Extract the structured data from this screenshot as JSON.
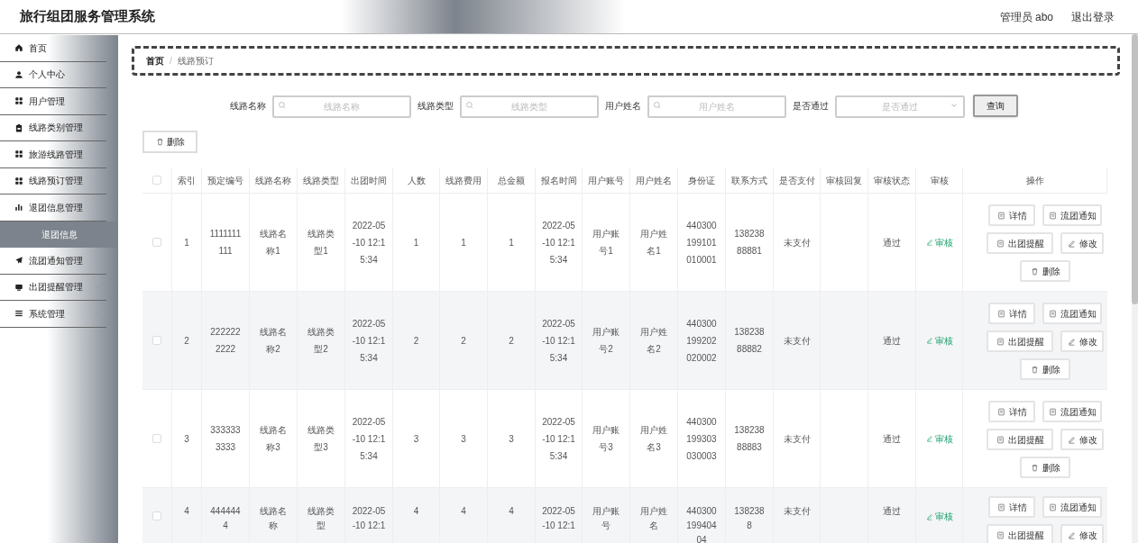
{
  "header": {
    "title": "旅行组团服务管理系统",
    "user": "管理员 abo",
    "logout": "退出登录"
  },
  "sidebar": {
    "items": [
      {
        "label": "首页",
        "kind": "link"
      },
      {
        "label": "个人中心",
        "kind": "group"
      },
      {
        "label": "用户管理",
        "kind": "group"
      },
      {
        "label": "线路类别管理",
        "kind": "group"
      },
      {
        "label": "旅游线路管理",
        "kind": "group"
      },
      {
        "label": "线路预订管理",
        "kind": "group"
      },
      {
        "label": "退团信息管理",
        "kind": "group",
        "children": [
          {
            "label": "退团信息",
            "selected": true
          }
        ]
      },
      {
        "label": "流团通知管理",
        "kind": "group"
      },
      {
        "label": "出团提醒管理",
        "kind": "group"
      },
      {
        "label": "系统管理",
        "kind": "group"
      }
    ]
  },
  "breadcrumb": {
    "items": [
      "首页",
      "线路预订"
    ],
    "separator": "/"
  },
  "search": {
    "fields": [
      {
        "label": "线路名称",
        "placeholder": "线路名称",
        "kind": "input"
      },
      {
        "label": "线路类型",
        "placeholder": "线路类型",
        "kind": "input"
      },
      {
        "label": "用户姓名",
        "placeholder": "用户姓名",
        "kind": "input"
      },
      {
        "label": "是否通过",
        "placeholder": "是否通过",
        "kind": "select"
      }
    ],
    "button": "查询"
  },
  "delete_button": "删除",
  "table": {
    "select_all_checked": false,
    "columns": [
      "索引",
      "预定编号",
      "线路名称",
      "线路类型",
      "出团时间",
      "人数",
      "线路费用",
      "总金额",
      "报名时间",
      "用户账号",
      "用户姓名",
      "身份证",
      "联系方式",
      "是否支付",
      "审核回复",
      "审核状态",
      "审核",
      "操作"
    ],
    "rows": [
      {
        "checked": false,
        "cells": [
          "1",
          "1111111111",
          "线路名称1",
          "线路类型1",
          "2022-05-10 12:15:34",
          "1",
          "1",
          "1",
          "2022-05-10 12:15:34",
          "用户账号1",
          "用户姓名1",
          "440300199101010001",
          "13823888881",
          "未支付",
          "",
          "通过"
        ],
        "audit": "审核",
        "actions": [
          "详情",
          "流团通知",
          "出团提醒",
          "修改",
          "删除"
        ]
      },
      {
        "checked": false,
        "cells": [
          "2",
          "2222222222",
          "线路名称2",
          "线路类型2",
          "2022-05-10 12:15:34",
          "2",
          "2",
          "2",
          "2022-05-10 12:15:34",
          "用户账号2",
          "用户姓名2",
          "440300199202020002",
          "13823888882",
          "未支付",
          "",
          "通过"
        ],
        "audit": "审核",
        "actions": [
          "详情",
          "流团通知",
          "出团提醒",
          "修改",
          "删除"
        ]
      },
      {
        "checked": false,
        "cells": [
          "3",
          "3333333333",
          "线路名称3",
          "线路类型3",
          "2022-05-10 12:15:34",
          "3",
          "3",
          "3",
          "2022-05-10 12:15:34",
          "用户账号3",
          "用户姓名3",
          "440300199303030003",
          "13823888883",
          "未支付",
          "",
          "通过"
        ],
        "audit": "审核",
        "actions": [
          "详情",
          "流团通知",
          "出团提醒",
          "修改",
          "删除"
        ]
      },
      {
        "checked": false,
        "cells": [
          "4",
          "4444444",
          "线路名称",
          "线路类型",
          "2022-05-10 12:1",
          "4",
          "4",
          "4",
          "2022-05-10 12:1",
          "用户账号",
          "用户姓名",
          "44030019940404",
          "1382388",
          "未支付",
          "",
          "通过"
        ],
        "audit": "审核",
        "actions": [
          "详情",
          "流团通知",
          "出团提醒",
          "修改"
        ]
      }
    ]
  }
}
